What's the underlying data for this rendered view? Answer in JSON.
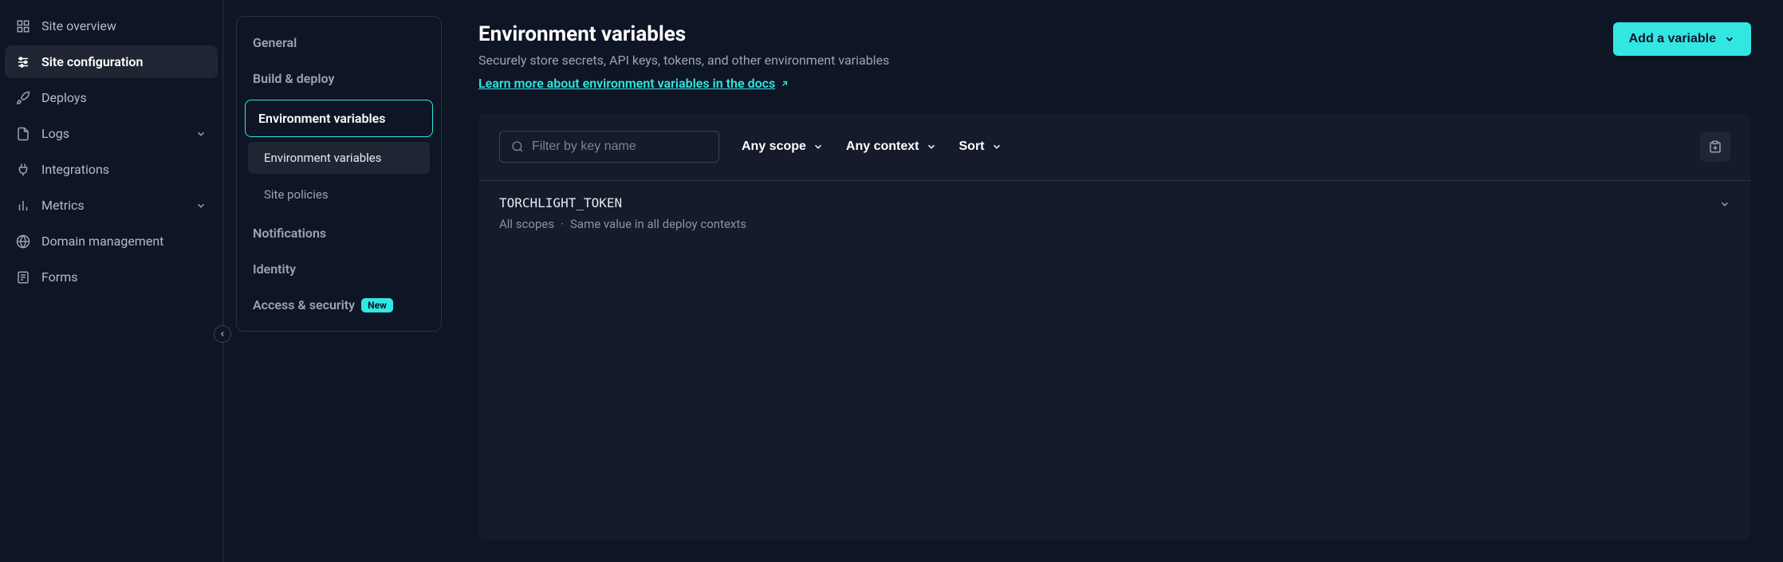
{
  "sidebar": {
    "items": [
      {
        "label": "Site overview"
      },
      {
        "label": "Site configuration"
      },
      {
        "label": "Deploys"
      },
      {
        "label": "Logs"
      },
      {
        "label": "Integrations"
      },
      {
        "label": "Metrics"
      },
      {
        "label": "Domain management"
      },
      {
        "label": "Forms"
      }
    ]
  },
  "subnav": {
    "items": {
      "general": "General",
      "build": "Build & deploy",
      "env": "Environment variables",
      "env_sub": "Environment variables",
      "site_policies": "Site policies",
      "notifications": "Notifications",
      "identity": "Identity",
      "access": "Access & security",
      "new_badge": "New"
    }
  },
  "main": {
    "title": "Environment variables",
    "subtitle": "Securely store secrets, API keys, tokens, and other environment variables",
    "learn_more": "Learn more about environment variables in the docs",
    "add_button": "Add a variable"
  },
  "toolbar": {
    "search_placeholder": "Filter by key name",
    "scope": "Any scope",
    "context": "Any context",
    "sort": "Sort"
  },
  "vars": [
    {
      "key": "TORCHLIGHT_TOKEN",
      "scopes": "All scopes",
      "contexts": "Same value in all deploy contexts"
    }
  ]
}
